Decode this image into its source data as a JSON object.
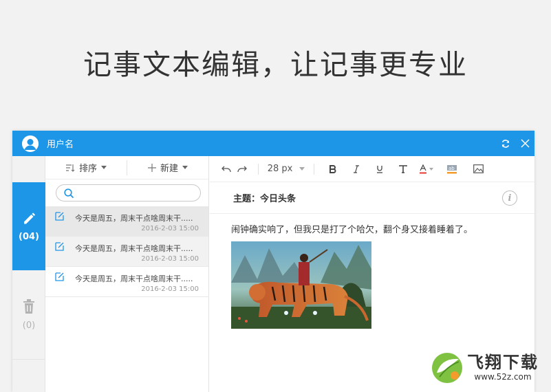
{
  "headline": "记事文本编辑，让记事更专业",
  "window": {
    "username": "用户名",
    "refresh_icon": "refresh-icon",
    "close_icon": "close-icon"
  },
  "rail": {
    "notes_count": "(04)",
    "trash_count": "(0)"
  },
  "list": {
    "sort_label": "排序",
    "new_label": "新建",
    "search_placeholder": "",
    "items": [
      {
        "title": "今天是周五，周末干点啥周末干.....",
        "date": "2016-2-03 15:00"
      },
      {
        "title": "今天是周五，周末干点啥周末干.....",
        "date": "2016-2-03 15:00"
      },
      {
        "title": "今天是周五，周末干点啥周末干.....",
        "date": "2016-2-03 15:00"
      }
    ]
  },
  "editor": {
    "font_size": "28 px",
    "subject": "主题：今日头条",
    "body": "闹钟确实响了，但我只是打了个哈欠，翻个身又接着睡着了。",
    "accent_blue": "#1e96e8"
  },
  "watermark": {
    "main": "飞翔下载",
    "url": "www.52z.com"
  }
}
